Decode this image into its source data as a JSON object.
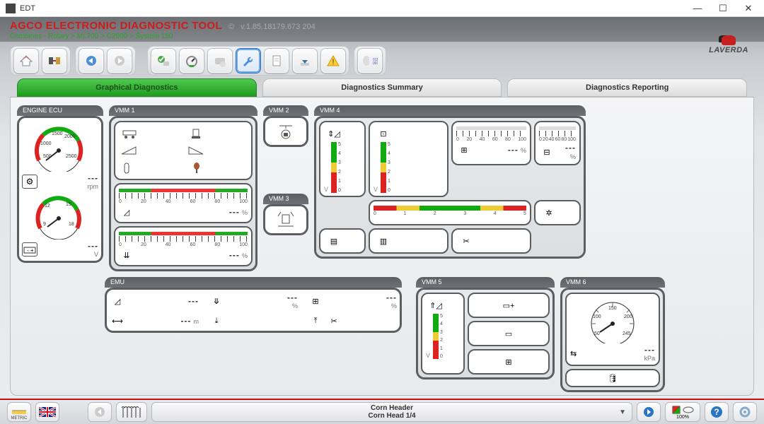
{
  "window": {
    "title": "EDT"
  },
  "app": {
    "title": "AGCO ELECTRONIC DIAGNOSTIC TOOL",
    "copyright": "©",
    "version": "v.1.85.18179.673 204",
    "breadcrumb": "Combines - Rotary > ML700 > C2000 > System 150",
    "brand": "LAVERDA"
  },
  "toolbar": {
    "home": "home-icon",
    "plug": "plug-icon",
    "back": "back-icon",
    "forward": "forward-icon",
    "check": "check-icon",
    "dial": "dial-icon",
    "device": "device-icon",
    "wrench": "wrench-icon",
    "doc": "document-icon",
    "download": "download-icon",
    "warn": "warning-icon",
    "binary": "binary-icon"
  },
  "tabs": [
    {
      "label": "Graphical Diagnostics",
      "active": true
    },
    {
      "label": "Diagnostics Summary",
      "active": false
    },
    {
      "label": "Diagnostics Reporting",
      "active": false
    }
  ],
  "modules": {
    "engine": {
      "title": "ENGINE ECU",
      "rpm": {
        "ticks": [
          "500",
          "1000",
          "1500",
          "2000",
          "2500"
        ],
        "unit": "rpm",
        "value": "---"
      },
      "volt": {
        "ticks": [
          "9",
          "12",
          "15",
          "18"
        ],
        "unit": "V",
        "value": "---"
      }
    },
    "vmm1": {
      "title": "VMM 1",
      "hbars": {
        "nums": [
          "0",
          "20",
          "40",
          "60",
          "80",
          "100"
        ],
        "pct1": {
          "value": "---",
          "unit": "%"
        },
        "pct2": {
          "value": "---",
          "unit": "%"
        }
      }
    },
    "vmm2": {
      "title": "VMM 2"
    },
    "vmm3": {
      "title": "VMM 3"
    },
    "vmm4": {
      "title": "VMM 4",
      "v_nums": [
        "5",
        "4",
        "3",
        "2",
        "1",
        "0"
      ],
      "v_unit": "V",
      "hbars": {
        "nums": [
          "0",
          "20",
          "40",
          "60",
          "80",
          "100"
        ],
        "unit": "%",
        "value": "---"
      },
      "center_nums": [
        "0",
        "1",
        "2",
        "3",
        "4",
        "5"
      ]
    },
    "vmm5": {
      "title": "VMM 5",
      "v_nums": [
        "5",
        "4",
        "3",
        "2",
        "1",
        "0"
      ],
      "v_unit": "V"
    },
    "vmm6": {
      "title": "VMM 6",
      "gauge_ticks": [
        "50",
        "100",
        "150",
        "200",
        "245"
      ],
      "unit": "kPa",
      "value": "---"
    },
    "emu": {
      "title": "EMU",
      "rows": [
        {
          "unit": "",
          "value": "---"
        },
        {
          "unit": "%",
          "value": "---"
        },
        {
          "unit": "%",
          "value": "---"
        },
        {
          "unit": "m",
          "value": "---"
        }
      ]
    }
  },
  "bottom": {
    "metric": "METRIC",
    "header_line1": "Corn Header",
    "header_line2": "Corn Head 1/4",
    "zoom": "100%"
  }
}
